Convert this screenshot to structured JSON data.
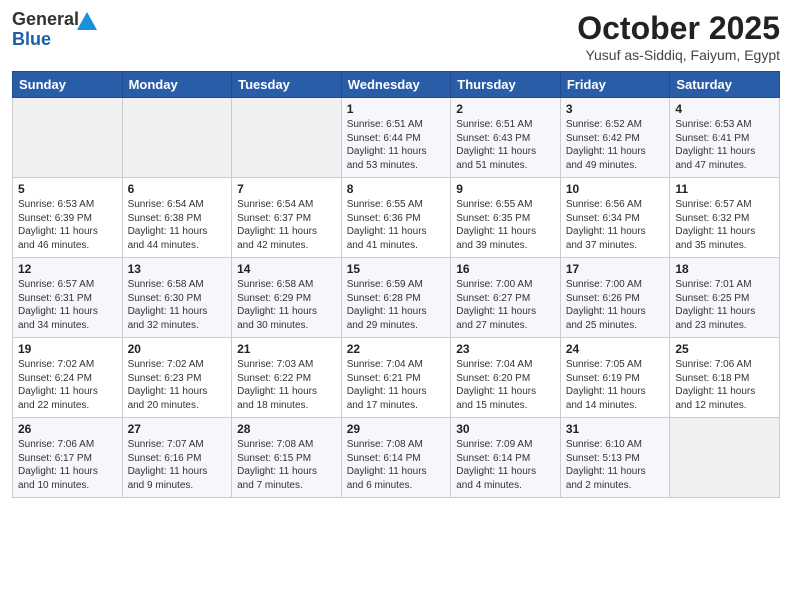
{
  "header": {
    "logo_line1": "General",
    "logo_line2": "Blue",
    "month_title": "October 2025",
    "subtitle": "Yusuf as-Siddiq, Faiyum, Egypt"
  },
  "days_of_week": [
    "Sunday",
    "Monday",
    "Tuesday",
    "Wednesday",
    "Thursday",
    "Friday",
    "Saturday"
  ],
  "weeks": [
    [
      {
        "day": "",
        "info": ""
      },
      {
        "day": "",
        "info": ""
      },
      {
        "day": "",
        "info": ""
      },
      {
        "day": "1",
        "info": "Sunrise: 6:51 AM\nSunset: 6:44 PM\nDaylight: 11 hours\nand 53 minutes."
      },
      {
        "day": "2",
        "info": "Sunrise: 6:51 AM\nSunset: 6:43 PM\nDaylight: 11 hours\nand 51 minutes."
      },
      {
        "day": "3",
        "info": "Sunrise: 6:52 AM\nSunset: 6:42 PM\nDaylight: 11 hours\nand 49 minutes."
      },
      {
        "day": "4",
        "info": "Sunrise: 6:53 AM\nSunset: 6:41 PM\nDaylight: 11 hours\nand 47 minutes."
      }
    ],
    [
      {
        "day": "5",
        "info": "Sunrise: 6:53 AM\nSunset: 6:39 PM\nDaylight: 11 hours\nand 46 minutes."
      },
      {
        "day": "6",
        "info": "Sunrise: 6:54 AM\nSunset: 6:38 PM\nDaylight: 11 hours\nand 44 minutes."
      },
      {
        "day": "7",
        "info": "Sunrise: 6:54 AM\nSunset: 6:37 PM\nDaylight: 11 hours\nand 42 minutes."
      },
      {
        "day": "8",
        "info": "Sunrise: 6:55 AM\nSunset: 6:36 PM\nDaylight: 11 hours\nand 41 minutes."
      },
      {
        "day": "9",
        "info": "Sunrise: 6:55 AM\nSunset: 6:35 PM\nDaylight: 11 hours\nand 39 minutes."
      },
      {
        "day": "10",
        "info": "Sunrise: 6:56 AM\nSunset: 6:34 PM\nDaylight: 11 hours\nand 37 minutes."
      },
      {
        "day": "11",
        "info": "Sunrise: 6:57 AM\nSunset: 6:32 PM\nDaylight: 11 hours\nand 35 minutes."
      }
    ],
    [
      {
        "day": "12",
        "info": "Sunrise: 6:57 AM\nSunset: 6:31 PM\nDaylight: 11 hours\nand 34 minutes."
      },
      {
        "day": "13",
        "info": "Sunrise: 6:58 AM\nSunset: 6:30 PM\nDaylight: 11 hours\nand 32 minutes."
      },
      {
        "day": "14",
        "info": "Sunrise: 6:58 AM\nSunset: 6:29 PM\nDaylight: 11 hours\nand 30 minutes."
      },
      {
        "day": "15",
        "info": "Sunrise: 6:59 AM\nSunset: 6:28 PM\nDaylight: 11 hours\nand 29 minutes."
      },
      {
        "day": "16",
        "info": "Sunrise: 7:00 AM\nSunset: 6:27 PM\nDaylight: 11 hours\nand 27 minutes."
      },
      {
        "day": "17",
        "info": "Sunrise: 7:00 AM\nSunset: 6:26 PM\nDaylight: 11 hours\nand 25 minutes."
      },
      {
        "day": "18",
        "info": "Sunrise: 7:01 AM\nSunset: 6:25 PM\nDaylight: 11 hours\nand 23 minutes."
      }
    ],
    [
      {
        "day": "19",
        "info": "Sunrise: 7:02 AM\nSunset: 6:24 PM\nDaylight: 11 hours\nand 22 minutes."
      },
      {
        "day": "20",
        "info": "Sunrise: 7:02 AM\nSunset: 6:23 PM\nDaylight: 11 hours\nand 20 minutes."
      },
      {
        "day": "21",
        "info": "Sunrise: 7:03 AM\nSunset: 6:22 PM\nDaylight: 11 hours\nand 18 minutes."
      },
      {
        "day": "22",
        "info": "Sunrise: 7:04 AM\nSunset: 6:21 PM\nDaylight: 11 hours\nand 17 minutes."
      },
      {
        "day": "23",
        "info": "Sunrise: 7:04 AM\nSunset: 6:20 PM\nDaylight: 11 hours\nand 15 minutes."
      },
      {
        "day": "24",
        "info": "Sunrise: 7:05 AM\nSunset: 6:19 PM\nDaylight: 11 hours\nand 14 minutes."
      },
      {
        "day": "25",
        "info": "Sunrise: 7:06 AM\nSunset: 6:18 PM\nDaylight: 11 hours\nand 12 minutes."
      }
    ],
    [
      {
        "day": "26",
        "info": "Sunrise: 7:06 AM\nSunset: 6:17 PM\nDaylight: 11 hours\nand 10 minutes."
      },
      {
        "day": "27",
        "info": "Sunrise: 7:07 AM\nSunset: 6:16 PM\nDaylight: 11 hours\nand 9 minutes."
      },
      {
        "day": "28",
        "info": "Sunrise: 7:08 AM\nSunset: 6:15 PM\nDaylight: 11 hours\nand 7 minutes."
      },
      {
        "day": "29",
        "info": "Sunrise: 7:08 AM\nSunset: 6:14 PM\nDaylight: 11 hours\nand 6 minutes."
      },
      {
        "day": "30",
        "info": "Sunrise: 7:09 AM\nSunset: 6:14 PM\nDaylight: 11 hours\nand 4 minutes."
      },
      {
        "day": "31",
        "info": "Sunrise: 6:10 AM\nSunset: 5:13 PM\nDaylight: 11 hours\nand 2 minutes."
      },
      {
        "day": "",
        "info": ""
      }
    ]
  ]
}
